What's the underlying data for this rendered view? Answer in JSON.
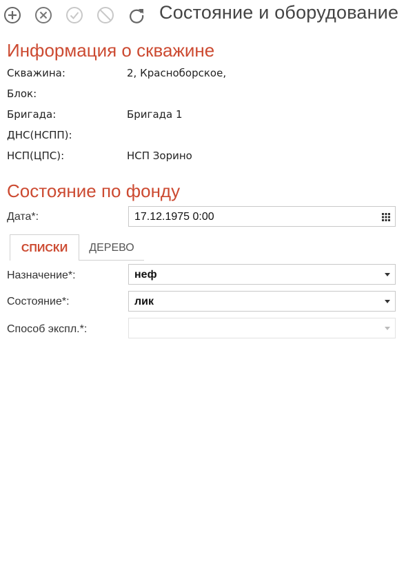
{
  "toolbar": {
    "buttons": [
      {
        "icon": "add-circle-icon",
        "enabled": true
      },
      {
        "icon": "cancel-circle-icon",
        "enabled": true
      },
      {
        "icon": "check-circle-icon",
        "enabled": false
      },
      {
        "icon": "block-circle-icon",
        "enabled": false
      },
      {
        "icon": "refresh-icon",
        "enabled": true
      }
    ],
    "title": "Состояние и оборудование"
  },
  "well_info": {
    "title": "Информация о скважине",
    "rows": [
      {
        "label": "Скважина:",
        "value": "2, Красноборское,"
      },
      {
        "label": "Блок:",
        "value": ""
      },
      {
        "label": "Бригада:",
        "value": "Бригада 1"
      },
      {
        "label": "ДНС(НСПП):",
        "value": ""
      },
      {
        "label": "НСП(ЦПС):",
        "value": "НСП Зорино"
      }
    ]
  },
  "fund_state": {
    "title": "Состояние по фонду",
    "date_label": "Дата*:",
    "date_value": "17.12.1975 0:00",
    "tabs": {
      "active": "СПИСКИ",
      "inactive": "ДЕРЕВО"
    },
    "fields": [
      {
        "label": "Назначение*:",
        "value": "неф"
      },
      {
        "label": "Состояние*:",
        "value": "лик"
      },
      {
        "label": "Способ экспл.*:",
        "value": ""
      }
    ]
  },
  "colors": {
    "accent": "#cc4a31",
    "icon_active": "#666666",
    "icon_disabled": "#c8c8c8"
  }
}
